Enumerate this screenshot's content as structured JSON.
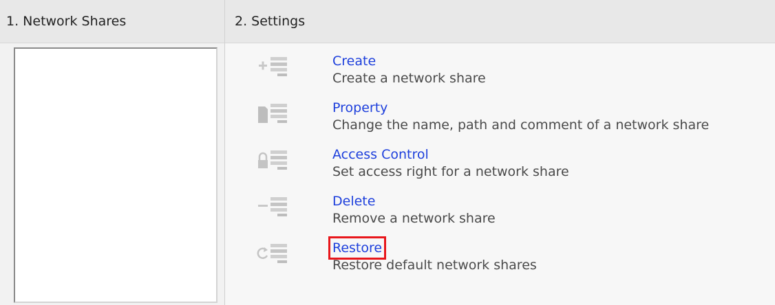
{
  "columns": {
    "shares_title": "1. Network Shares",
    "settings_title": "2. Settings"
  },
  "actions": [
    {
      "title": "Create",
      "description": "Create a network share",
      "icon": "create-share-icon"
    },
    {
      "title": "Property",
      "description": "Change the name, path and comment of a network share",
      "icon": "property-share-icon"
    },
    {
      "title": "Access Control",
      "description": "Set access right for a network share",
      "icon": "access-control-icon"
    },
    {
      "title": "Delete",
      "description": "Remove a network share",
      "icon": "delete-share-icon"
    },
    {
      "title": "Restore",
      "description": "Restore default network shares",
      "icon": "restore-share-icon"
    }
  ],
  "highlighted_action": "Restore",
  "colors": {
    "link": "#1d3fdc",
    "highlight": "#e8161b",
    "icon_gray": "#c8c8c8"
  }
}
